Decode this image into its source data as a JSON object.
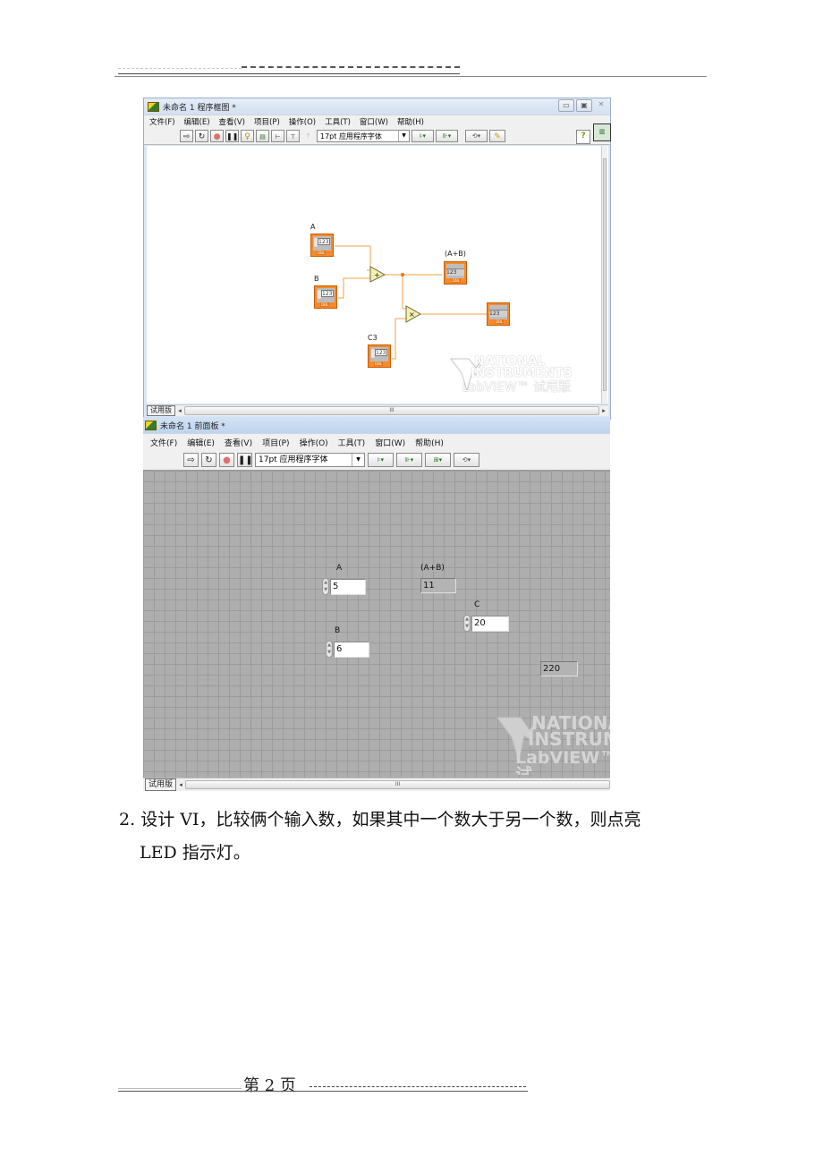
{
  "document": {
    "task": {
      "number": "2.",
      "line1": "设计 VI，比较俩个输入数，如果其中一个数大于另一个数，则点亮",
      "line2": "LED 指示灯。"
    },
    "footer": {
      "page_label": "第  2  页"
    }
  },
  "block_diagram_window": {
    "title": "未命名 1 程序框图 *",
    "window_buttons": [
      "minimize",
      "maximize",
      "close"
    ],
    "menu": [
      "文件(F)",
      "编辑(E)",
      "查看(V)",
      "项目(P)",
      "操作(O)",
      "工具(T)",
      "窗口(W)",
      "帮助(H)"
    ],
    "toolbar": {
      "font": "17pt 应用程序字体",
      "icons": [
        "run-arrow-icon",
        "run-continuous-icon",
        "abort-icon",
        "pause-icon",
        "highlight-execution-icon",
        "retain-wire-values-icon",
        "step-into-icon",
        "step-over-icon",
        "step-out-icon",
        "align-icon",
        "distribute-icon",
        "reorder-icon",
        "cleanup-icon",
        "help-icon"
      ]
    },
    "nodes": {
      "control_a": {
        "label": "A",
        "type_tag": "DBL",
        "display": "123"
      },
      "control_b": {
        "label": "B",
        "type_tag": "DBL",
        "display": "123"
      },
      "control_c": {
        "label": "C3",
        "type_tag": "DBL",
        "display": "123"
      },
      "indicator_sum": {
        "label": "(A+B)",
        "type_tag": "DBL",
        "display": "123"
      },
      "indicator_product": {
        "label": "",
        "type_tag": "DBL",
        "display": "123"
      },
      "add_function": {
        "symbol": "+"
      },
      "multiply_function": {
        "symbol": "×"
      }
    },
    "watermark": {
      "line1": "NATIONAL",
      "line2": "INSTRUMENTS",
      "line3": "LabVIEW™ 试用版"
    },
    "trial_tab": "试用版",
    "scroll_grip": "III",
    "wire_color": "#f5a043"
  },
  "front_panel_window": {
    "title": "未命名 1 前面板 *",
    "menu": [
      "文件(F)",
      "编辑(E)",
      "查看(V)",
      "项目(P)",
      "操作(O)",
      "工具(T)",
      "窗口(W)",
      "帮助(H)"
    ],
    "toolbar": {
      "font": "17pt 应用程序字体",
      "icons": [
        "run-arrow-icon",
        "run-continuous-icon",
        "abort-icon",
        "pause-icon",
        "align-icon",
        "distribute-icon",
        "resize-icon",
        "reorder-icon"
      ]
    },
    "controls": {
      "a": {
        "label": "A",
        "value": "5"
      },
      "b": {
        "label": "B",
        "value": "6"
      },
      "c": {
        "label": "C",
        "value": "20"
      }
    },
    "indicators": {
      "sum": {
        "label": "(A+B)",
        "value": "11"
      },
      "product": {
        "label": "",
        "value": "220"
      }
    },
    "watermark": {
      "line1": "NATIONA",
      "line2": "INSTRUM",
      "line3": "LabVIEW™ 试"
    },
    "trial_tab": "试用版",
    "scroll_grip": "III"
  }
}
